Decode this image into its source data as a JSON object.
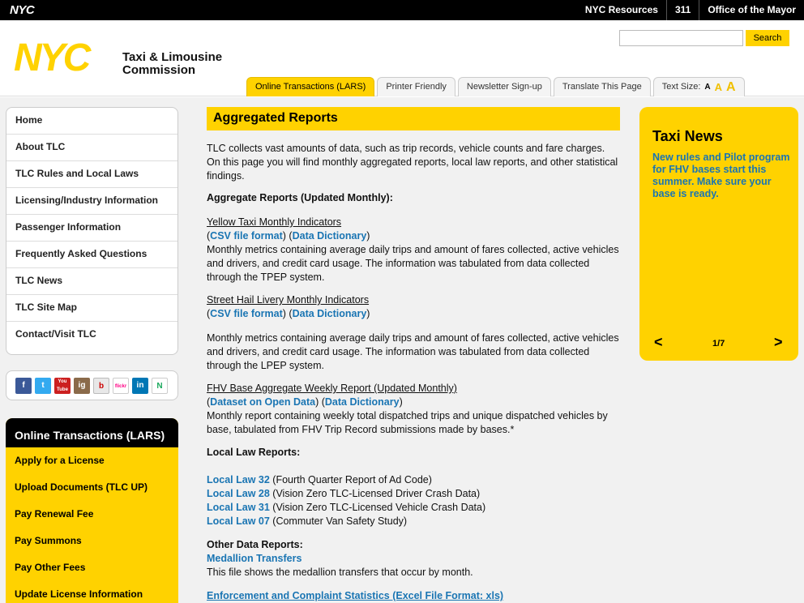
{
  "topbar": {
    "logo_text": "NYC",
    "links": [
      "NYC Resources",
      "311",
      "Office of the Mayor"
    ]
  },
  "header": {
    "logo_text": "NYC",
    "agency_line1": "Taxi & Limousine",
    "agency_line2": "Commission",
    "search_placeholder": "",
    "search_button": "Search",
    "tabs": [
      "Online Transactions (LARS)",
      "Printer Friendly",
      "Newsletter Sign-up",
      "Translate This Page"
    ],
    "text_size_label": "Text Size:",
    "text_size_options": [
      "A",
      "A",
      "A"
    ]
  },
  "leftnav": {
    "items": [
      "Home",
      "About TLC",
      "TLC Rules and Local Laws",
      "Licensing/Industry Information",
      "Passenger Information",
      "Frequently Asked Questions",
      "TLC News",
      "TLC Site Map",
      "Contact/Visit TLC"
    ]
  },
  "social": [
    "f",
    "t",
    "You Tube",
    "ig",
    "b",
    "flickr",
    "in",
    "N"
  ],
  "lars": {
    "heading": "Online Transactions (LARS)",
    "items": [
      "Apply for a License",
      "Upload Documents (TLC UP)",
      "Pay Renewal Fee",
      "Pay Summons",
      "Pay Other Fees",
      "Update License Information"
    ]
  },
  "main": {
    "title": "Aggregated Reports",
    "intro": "TLC collects vast amounts of data, such as trip records, vehicle counts and fare charges. On this page you will find monthly aggregated reports, local law reports, and other statistical findings.",
    "aggregate_heading": "Aggregate Reports (Updated Monthly):",
    "reports": [
      {
        "title": "Yellow Taxi Monthly Indicators",
        "link1": "CSV file format",
        "link2": "Data Dictionary",
        "desc": "Monthly metrics containing average daily trips and amount of fares collected, active vehicles and drivers, and credit card usage. The information was tabulated from data collected through the TPEP system."
      },
      {
        "title": "Street Hail Livery Monthly Indicators",
        "link1": "CSV file format",
        "link2": "Data Dictionary",
        "desc": "Monthly metrics containing average daily trips and amount of fares collected, active vehicles and drivers, and credit card usage. The information was tabulated from data collected through the LPEP system."
      },
      {
        "title": "FHV Base Aggregate Weekly Report (Updated Monthly)",
        "link1": "Dataset on Open Data",
        "link2": "Data Dictionary",
        "desc": "Monthly report containing weekly total dispatched trips and unique dispatched vehicles by base, tabulated from FHV Trip Record submissions made by bases.*"
      }
    ],
    "local_law_heading": "Local Law Reports:",
    "local_laws": [
      {
        "link": "Local Law 32",
        "desc": " (Fourth Quarter Report of Ad Code)"
      },
      {
        "link": "Local Law 28",
        "desc": " (Vision Zero TLC-Licensed Driver Crash Data)"
      },
      {
        "link": "Local Law 31",
        "desc": " (Vision Zero TLC-Licensed Vehicle Crash Data)"
      },
      {
        "link": "Local Law 07",
        "desc": " (Commuter Van Safety Study)"
      }
    ],
    "other_heading": "Other Data Reports:",
    "medallion_link": "Medallion Transfers",
    "medallion_desc": "This file shows the medallion transfers that occur by month.",
    "enforcement_link": "Enforcement and Complaint Statistics (Excel File Format: xls)"
  },
  "widget": {
    "title": "Taxi News",
    "text": "New rules and Pilot program for FHV bases start this summer. Make sure your base is ready.",
    "prev": "<",
    "next": ">",
    "counter": "1/7"
  }
}
